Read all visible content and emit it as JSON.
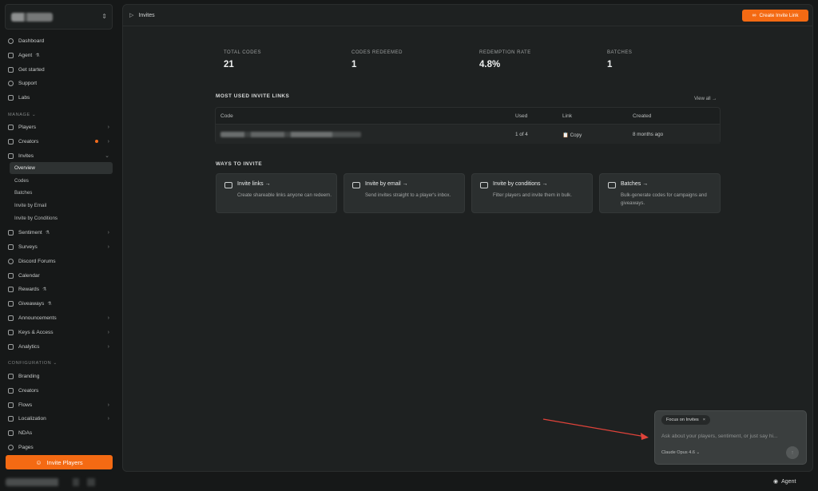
{
  "sidebar": {
    "top_items": [
      {
        "label": "Dashboard",
        "icon": "dashboard-icon"
      },
      {
        "label": "Agent",
        "icon": "agent-icon",
        "beta": "Ꮥ"
      },
      {
        "label": "Get started",
        "icon": "rocket-icon"
      },
      {
        "label": "Support",
        "icon": "help-icon"
      },
      {
        "label": "Labs",
        "icon": "flask-icon"
      }
    ],
    "manage_label": "MANAGE",
    "manage_items": [
      {
        "label": "Players"
      },
      {
        "label": "Creators"
      },
      {
        "label": "Invites"
      }
    ],
    "invite_sub_items": [
      "Overview",
      "Codes",
      "Batches",
      "Invite by Email",
      "Invite by Conditions"
    ],
    "manage_items_2": [
      {
        "label": "Sentiment"
      },
      {
        "label": "Surveys"
      },
      {
        "label": "Discord Forums"
      },
      {
        "label": "Calendar"
      },
      {
        "label": "Rewards"
      },
      {
        "label": "Giveaways"
      },
      {
        "label": "Announcements"
      },
      {
        "label": "Keys & Access"
      },
      {
        "label": "Analytics"
      }
    ],
    "config_label": "CONFIGURATION",
    "config_items": [
      {
        "label": "Branding"
      },
      {
        "label": "Creators"
      },
      {
        "label": "Flows"
      },
      {
        "label": "Localization"
      },
      {
        "label": "NDAs"
      },
      {
        "label": "Pages"
      }
    ],
    "invite_players_label": "Invite Players",
    "chevron": "›",
    "chevron_down": "⌄",
    "updown": "⇕",
    "flask": "⚗"
  },
  "header": {
    "title": "Invites",
    "create_label": "Create Invite Link"
  },
  "stats": [
    {
      "label": "TOTAL CODES",
      "value": "21"
    },
    {
      "label": "CODES REDEEMED",
      "value": "1"
    },
    {
      "label": "REDEMPTION RATE",
      "value": "4.8%"
    },
    {
      "label": "BATCHES",
      "value": "1"
    }
  ],
  "most_used": {
    "title": "MOST USED INVITE LINKS",
    "view_all": "View all →",
    "columns": [
      "Code",
      "Used",
      "Link",
      "Created"
    ],
    "row": {
      "used": "1 of 4",
      "link": "Copy",
      "created": "8 months ago"
    }
  },
  "ways": {
    "title": "WAYS TO INVITE",
    "cards": [
      {
        "title": "Invite links →",
        "desc": "Create shareable links anyone can redeem."
      },
      {
        "title": "Invite by email →",
        "desc": "Send invites straight to a player's inbox."
      },
      {
        "title": "Invite by conditions →",
        "desc": "Filter players and invite them in bulk."
      },
      {
        "title": "Batches →",
        "desc": "Bulk-generate codes for campaigns and giveaways."
      }
    ]
  },
  "chat": {
    "chip": "Focus on Invites",
    "chip_close": "×",
    "placeholder": "Ask about your players, sentiment, or just say hi...",
    "model": "Claude Opus 4.6 ⌄",
    "send": "↑"
  },
  "footer": {
    "agent": "Agent"
  },
  "colors": {
    "accent": "#f46a13",
    "background": "#161818",
    "panel": "#1e2121"
  }
}
